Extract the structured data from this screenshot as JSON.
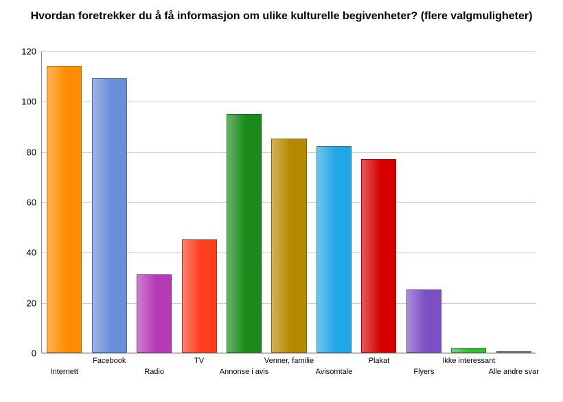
{
  "chart_data": {
    "type": "bar",
    "title": "Hvordan foretrekker du å få informasjon om ulike kulturelle begivenheter? (flere valgmuligheter)",
    "xlabel": "",
    "ylabel": "",
    "ylim": [
      0,
      120
    ],
    "yticks": [
      0,
      20,
      40,
      60,
      80,
      100,
      120
    ],
    "categories": [
      "Internett",
      "Facebook",
      "Radio",
      "TV",
      "Annonse i avis",
      "Venner, familie",
      "Avisomtale",
      "Plakat",
      "Flyers",
      "Ikke interessant",
      "Alle andre svar"
    ],
    "values": [
      114,
      109,
      31,
      45,
      95,
      85,
      82,
      77,
      25,
      2,
      0
    ],
    "colors": [
      "#ff8c00",
      "#6a8ed8",
      "#b53ab5",
      "#ff3d1f",
      "#1a8a1a",
      "#b58900",
      "#1fa7e6",
      "#d60000",
      "#7d4fc4",
      "#2fbf2f",
      "#808080"
    ]
  }
}
